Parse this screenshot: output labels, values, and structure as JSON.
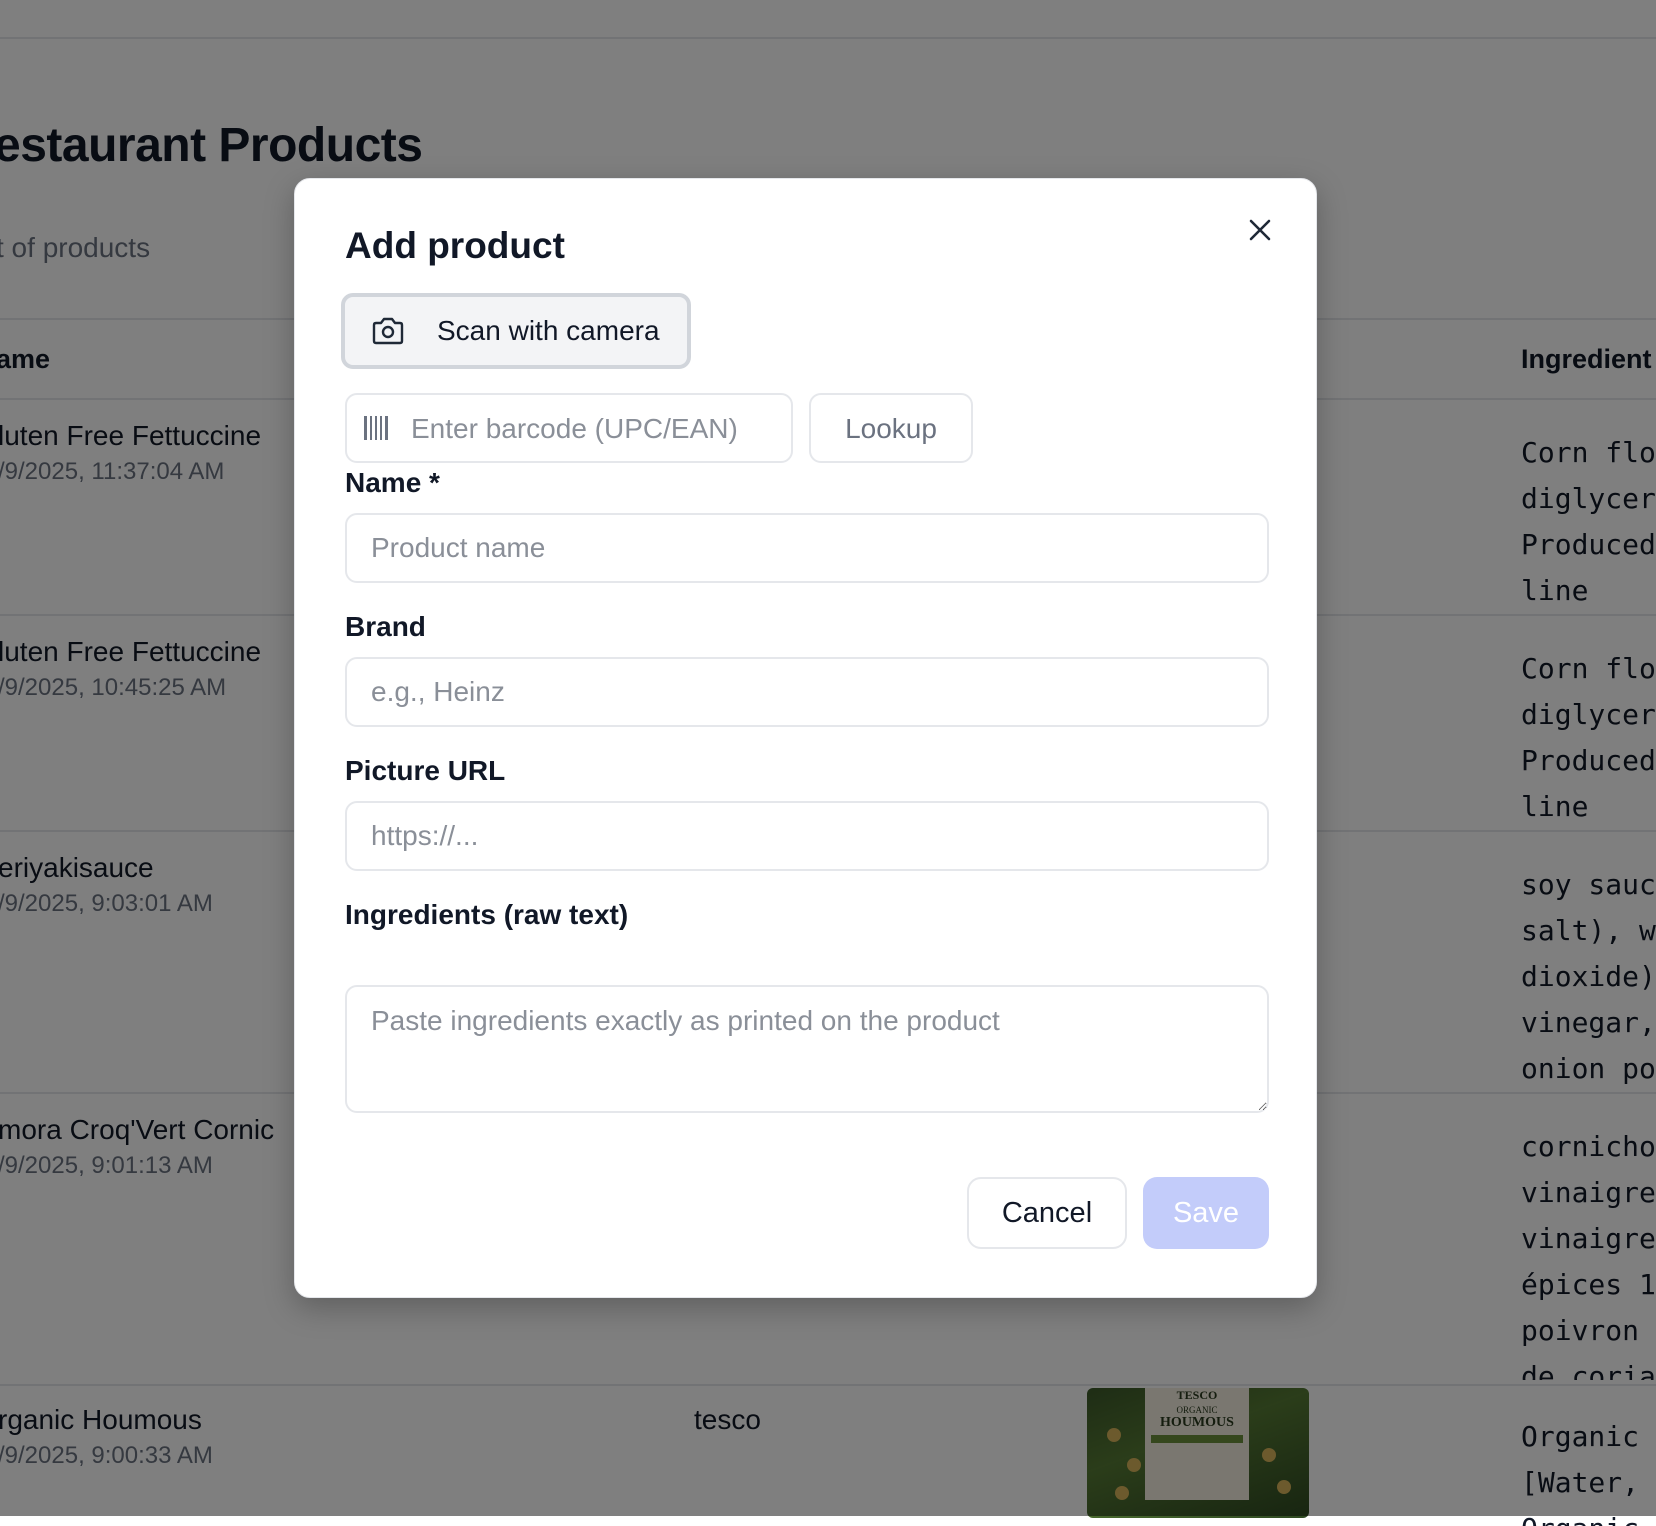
{
  "background": {
    "page_title": "estaurant Products",
    "page_subtitle": "t of products",
    "columns": {
      "name": "ame",
      "ingredients": "Ingredient"
    },
    "rows": [
      {
        "name": "luten Free Fettuccine",
        "date": "/9/2025, 11:37:04 AM",
        "brand": "",
        "ingredients": "Corn flo\ndiglycer\nProduced\nline"
      },
      {
        "name": "luten Free Fettuccine",
        "date": "/9/2025, 10:45:25 AM",
        "brand": "",
        "ingredients": "Corn flo\ndiglycer\nProduced\nline"
      },
      {
        "name": "eriyakisauce",
        "date": "/9/2025, 9:03:01 AM",
        "brand": "",
        "ingredients": "soy sauc\nsalt), w\ndioxide)\nvinegar,\nonion po"
      },
      {
        "name": "mora Croq'Vert Cornic",
        "date": "/9/2025, 9:01:13 AM",
        "brand": "",
        "ingredients": "cornicho\nvinaigre\nvinaigre\népices 1\npoivron \nde coria"
      },
      {
        "name": "rganic Houmous",
        "date": "/9/2025, 9:00:33 AM",
        "brand": "tesco",
        "ingredients": "Organic \n[Water, \nOrganic "
      }
    ],
    "thumbnail_label": {
      "brand": "TESCO",
      "line1": "ORGANIC",
      "line2": "HOUMOUS"
    }
  },
  "modal": {
    "title": "Add product",
    "scan_button_label": "Scan with camera",
    "barcode_placeholder": "Enter barcode (UPC/EAN)",
    "barcode_value": "",
    "lookup_label": "Lookup",
    "name_label": "Name *",
    "name_placeholder": "Product name",
    "brand_label": "Brand",
    "brand_placeholder": "e.g., Heinz",
    "picture_label": "Picture URL",
    "picture_placeholder": "https://...",
    "ingredients_label": "Ingredients (raw text)",
    "ingredients_placeholder": "Paste ingredients exactly as printed on the product",
    "cancel_label": "Cancel",
    "save_label": "Save"
  },
  "colors": {
    "save_button_disabled": "#c3ccfa",
    "overlay": "rgba(0,0,0,0.5)"
  }
}
